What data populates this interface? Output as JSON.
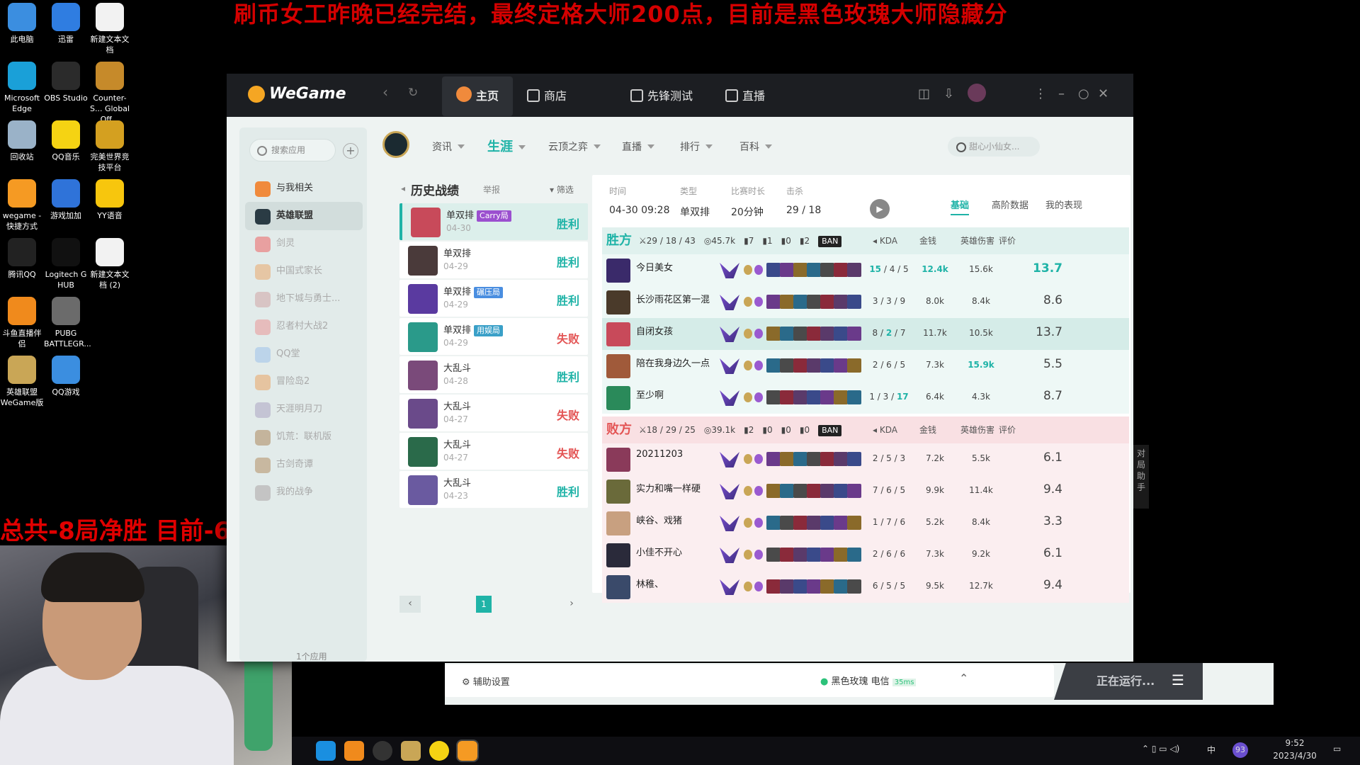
{
  "banner": "刷币女工昨晚已经完结，最终定格大师200点，目前是黑色玫瑰大师隐藏分",
  "overlay_text": "总共-8局净胜   目前-6",
  "desktop_icons": [
    {
      "label": "此电脑",
      "color": "#3b8ee0"
    },
    {
      "label": "迅雷",
      "color": "#2f7de1"
    },
    {
      "label": "新建文本文档",
      "color": "#f2f2f2"
    },
    {
      "label": "Microsoft Edge",
      "color": "#1aa0d8"
    },
    {
      "label": "OBS Studio",
      "color": "#2b2b2b"
    },
    {
      "label": "Counter-S... Global Off...",
      "color": "#c68a2a"
    },
    {
      "label": "回收站",
      "color": "#9ab2c8"
    },
    {
      "label": "QQ音乐",
      "color": "#f5d313"
    },
    {
      "label": "完美世界竞技平台",
      "color": "#d4a020"
    },
    {
      "label": "wegame - 快捷方式",
      "color": "#f59a23"
    },
    {
      "label": "游戏加加",
      "color": "#2f73d9"
    },
    {
      "label": "YY语音",
      "color": "#f7c60d"
    },
    {
      "label": "腾讯QQ",
      "color": "#222222"
    },
    {
      "label": "Logitech G HUB",
      "color": "#111111"
    },
    {
      "label": "新建文本文档 (2)",
      "color": "#f2f2f2"
    },
    {
      "label": "斗鱼直播伴侣",
      "color": "#f08a1c"
    },
    {
      "label": "PUBG BATTLEGR...",
      "color": "#6b6b6b"
    },
    {
      "label": "英雄联盟 WeGame版",
      "color": "#c9a656"
    },
    {
      "label": "QQ游戏",
      "color": "#3b8ee0"
    }
  ],
  "titlebar": {
    "logo": "WeGame",
    "tabs": [
      {
        "label": "主页",
        "active": true
      },
      {
        "label": "商店"
      },
      {
        "label": "先锋测试"
      },
      {
        "label": "直播"
      }
    ]
  },
  "sidebar": {
    "search_placeholder": "搜索应用",
    "add": "+",
    "items": [
      {
        "label": "与我相关",
        "color": "#f08a3c"
      },
      {
        "label": "英雄联盟",
        "active": true,
        "color": "#2a3b44"
      },
      {
        "label": "剑灵",
        "color": "#e8a0a0"
      },
      {
        "label": "中国式家长",
        "color": "#e6c6a4"
      },
      {
        "label": "地下城与勇士...",
        "color": "#d8c4c4"
      },
      {
        "label": "忍者村大战2",
        "color": "#e6bcbc"
      },
      {
        "label": "QQ堂",
        "color": "#bcd4ea"
      },
      {
        "label": "冒险岛2",
        "color": "#e6c4a0"
      },
      {
        "label": "天涯明月刀",
        "color": "#c4c4d4"
      },
      {
        "label": "饥荒：联机版",
        "color": "#c4b49c"
      },
      {
        "label": "古剑奇谭",
        "color": "#c8b8a0"
      },
      {
        "label": "我的战争",
        "color": "#c4c4c4"
      }
    ],
    "footer": "1个应用"
  },
  "subnav": {
    "items": [
      {
        "label": "资讯"
      },
      {
        "label": "生涯",
        "active": true
      },
      {
        "label": "云顶之弈"
      },
      {
        "label": "直播"
      },
      {
        "label": "排行"
      },
      {
        "label": "百科"
      }
    ],
    "search_placeholder": "甜心小仙女..."
  },
  "history": {
    "title": "历史战绩",
    "report": "举报",
    "filter": "筛选",
    "matches": [
      {
        "mode": "单双排",
        "tag": "Carry局",
        "tag_color": "#9b4fcf",
        "date": "04-30",
        "result": "胜利",
        "win": true,
        "color": "#c84a5a"
      },
      {
        "mode": "单双排",
        "date": "04-29",
        "result": "胜利",
        "win": true,
        "color": "#4a3a3a"
      },
      {
        "mode": "单双排",
        "tag": "碾压局",
        "tag_color": "#4a8ee0",
        "date": "04-29",
        "result": "胜利",
        "win": true,
        "color": "#5a3aa0"
      },
      {
        "mode": "单双排",
        "tag": "用娱局",
        "tag_color": "#3aa0c8",
        "date": "04-29",
        "result": "失败",
        "win": false,
        "color": "#2a9a8a"
      },
      {
        "mode": "大乱斗",
        "date": "04-28",
        "result": "胜利",
        "win": true,
        "color": "#7a4a7a"
      },
      {
        "mode": "大乱斗",
        "date": "04-27",
        "result": "失败",
        "win": false,
        "color": "#6a4a8a"
      },
      {
        "mode": "大乱斗",
        "date": "04-27",
        "result": "失败",
        "win": false,
        "color": "#2a6a4a"
      },
      {
        "mode": "大乱斗",
        "date": "04-23",
        "result": "胜利",
        "win": true,
        "color": "#6a5aa0"
      }
    ],
    "page": "1"
  },
  "detail": {
    "meta": [
      {
        "label": "时间",
        "value": "04-30 09:28"
      },
      {
        "label": "类型",
        "value": "单双排"
      },
      {
        "label": "比赛时长",
        "value": "20分钟"
      },
      {
        "label": "击杀",
        "value": "29 / 18"
      }
    ],
    "tabs": [
      {
        "label": "基础",
        "active": true
      },
      {
        "label": "高阶数据"
      },
      {
        "label": "我的表现"
      }
    ],
    "col_headers": {
      "kda": "KDA",
      "gold": "金钱",
      "dmg": "英雄伤害",
      "score": "评价"
    },
    "ban": "BAN",
    "teams": [
      {
        "name": "胜方",
        "win": true,
        "kda": "29 / 18 / 43",
        "gold": "45.7k",
        "towers": "7",
        "dragons": "1",
        "barons": "0",
        "heralds": "2",
        "players": [
          {
            "name": "今日美女",
            "kda_k": "15",
            "kda_d": "4",
            "kda_a": "5",
            "gold": "12.4k",
            "dmg": "15.6k",
            "score": "13.7",
            "color": "#3a2a6a",
            "score_hi": true,
            "gold_hi": true,
            "kda_hi": true
          },
          {
            "name": "长沙雨花区第一混",
            "kda_k": "3",
            "kda_d": "3",
            "kda_a": "9",
            "gold": "8.0k",
            "dmg": "8.4k",
            "score": "8.6",
            "color": "#4a3a2a"
          },
          {
            "name": "自闭女孩",
            "kda_k": "8",
            "kda_d": "2",
            "kda_a": "7",
            "gold": "11.7k",
            "dmg": "10.5k",
            "score": "13.7",
            "color": "#c84a5a",
            "me": true
          },
          {
            "name": "陪在我身边久一点",
            "kda_k": "2",
            "kda_d": "6",
            "kda_a": "5",
            "gold": "7.3k",
            "dmg": "15.9k",
            "score": "5.5",
            "color": "#a05a3a",
            "dmg_hi": true
          },
          {
            "name": "至少啊",
            "kda_k": "1",
            "kda_d": "3",
            "kda_a": "17",
            "gold": "6.4k",
            "dmg": "4.3k",
            "score": "8.7",
            "color": "#2a8a5a"
          }
        ]
      },
      {
        "name": "败方",
        "win": false,
        "kda": "18 / 29 / 25",
        "gold": "39.1k",
        "towers": "2",
        "dragons": "0",
        "barons": "0",
        "heralds": "0",
        "players": [
          {
            "name": "20211203",
            "kda_k": "2",
            "kda_d": "5",
            "kda_a": "3",
            "gold": "7.2k",
            "dmg": "5.5k",
            "score": "6.1",
            "color": "#8a3a5a"
          },
          {
            "name": "实力和嘴一样硬",
            "kda_k": "7",
            "kda_d": "6",
            "kda_a": "5",
            "gold": "9.9k",
            "dmg": "11.4k",
            "score": "9.4",
            "color": "#6a6a3a"
          },
          {
            "name": "峡谷、戏猪",
            "kda_k": "1",
            "kda_d": "7",
            "kda_a": "6",
            "gold": "5.2k",
            "dmg": "8.4k",
            "score": "3.3",
            "color": "#c8a080"
          },
          {
            "name": "小佳不开心",
            "kda_k": "2",
            "kda_d": "6",
            "kda_a": "6",
            "gold": "7.3k",
            "dmg": "9.2k",
            "score": "6.1",
            "color": "#2a2a3a"
          },
          {
            "name": "林稚、",
            "kda_k": "6",
            "kda_d": "5",
            "kda_a": "5",
            "gold": "9.5k",
            "dmg": "12.7k",
            "score": "9.4",
            "color": "#3a4a6a"
          }
        ]
      }
    ]
  },
  "bottombar": {
    "settings": "辅助设置",
    "server": "黑色玫瑰 电信",
    "ping": "35ms",
    "running": "正在运行..."
  },
  "right_panel": "对局助手",
  "tray": {
    "ime": "中",
    "time": "9:52",
    "date": "2023/4/30",
    "badge": "93"
  }
}
